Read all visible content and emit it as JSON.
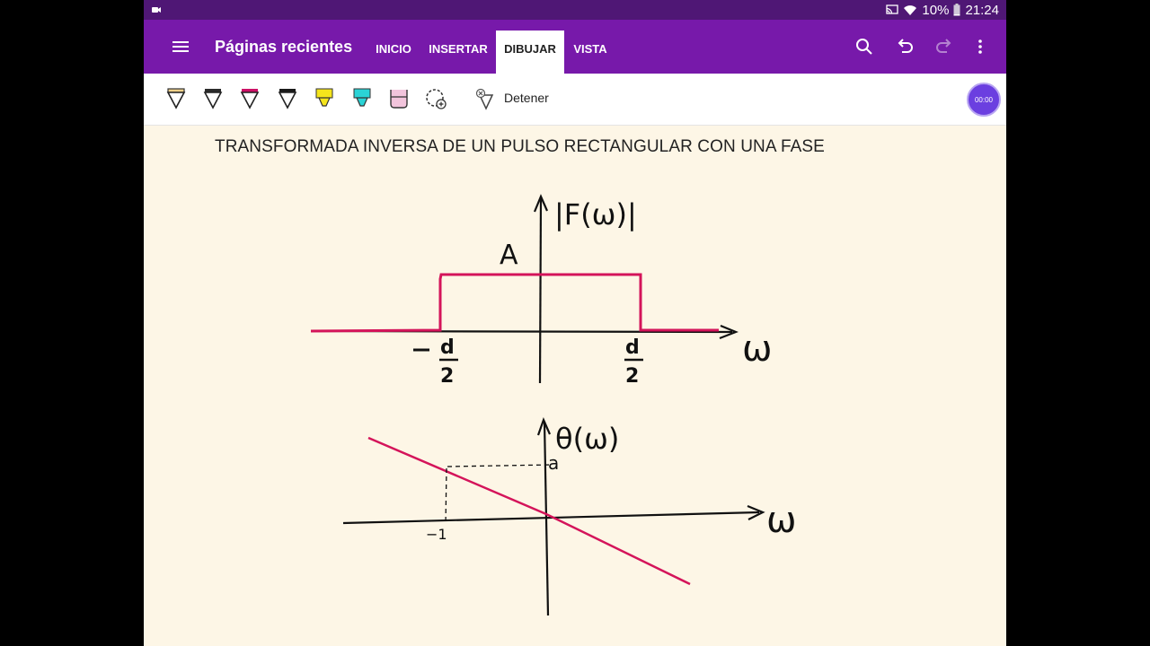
{
  "status_bar": {
    "battery": "10%",
    "time": "21:24"
  },
  "app_bar": {
    "title": "Páginas recientes",
    "tabs": [
      {
        "label": "INICIO",
        "active": false
      },
      {
        "label": "INSERTAR",
        "active": false
      },
      {
        "label": "DIBUJAR",
        "active": true
      },
      {
        "label": "VISTA",
        "active": false
      }
    ]
  },
  "ribbon": {
    "pens": [
      {
        "name": "pen-black",
        "color": "#1a1a1a"
      },
      {
        "name": "pen-dark",
        "color": "#2b2b2b"
      },
      {
        "name": "pen-magenta",
        "color": "#cc1166"
      },
      {
        "name": "pen-selected",
        "color": "#1a1a1a"
      },
      {
        "name": "highlighter-yellow",
        "color": "#f5e51c"
      },
      {
        "name": "highlighter-cyan",
        "color": "#2ad3d6"
      },
      {
        "name": "highlighter-pink",
        "color": "#f2c4dc"
      }
    ],
    "stop_label": "Detener",
    "timer": "00:00"
  },
  "page": {
    "title": "TRANSFORMADA INVERSA DE UN PULSO RECTANGULAR CON UNA FASE"
  },
  "drawing": {
    "magnitude_label": "|F(ω)|",
    "amplitude_label": "A",
    "axis_label": "ω",
    "neg_edge_label": "−d/2",
    "pos_edge_label": "d/2",
    "phase_label": "θ(ω)",
    "phase_y_mark": "a",
    "phase_x_mark": "−1",
    "colors": {
      "ink": "#111111",
      "curve": "#d4145a"
    }
  }
}
